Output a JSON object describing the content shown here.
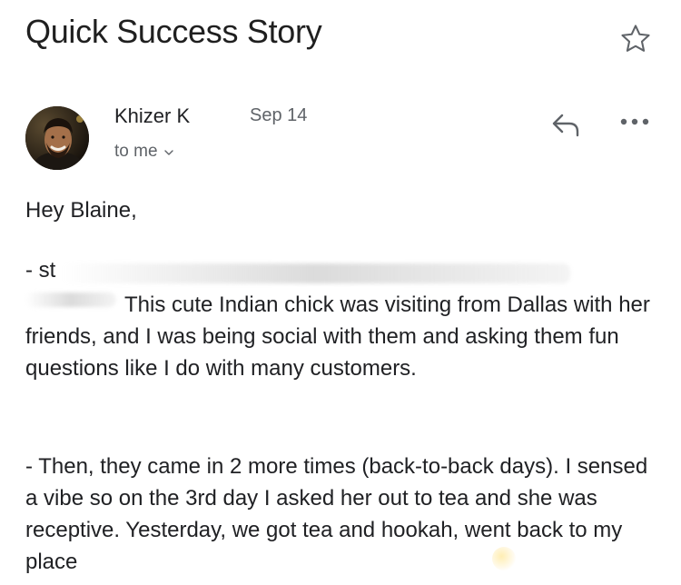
{
  "email": {
    "subject": "Quick Success Story",
    "sender": "Khizer K",
    "date": "Sep 14",
    "recipient": "to me",
    "greeting": "Hey Blaine,",
    "blurred_lead": "- st",
    "paragraph1": "This cute Indian chick was visiting from Dallas with her friends, and I was being social with them and asking them fun questions like I do with many customers.",
    "paragraph2": "- Then, they came in 2 more times (back-to-back days). I sensed a vibe so on the 3rd day I asked her out to tea and she was receptive. Yesterday, we got tea and hookah, went back to my place"
  },
  "icons": {
    "star": "star-outline-icon",
    "reply": "reply-icon",
    "more": "more-horizontal-icon",
    "chevron": "chevron-down-icon"
  },
  "colors": {
    "text": "#202124",
    "secondary_text": "#5f6368",
    "icon": "#5f6368"
  }
}
